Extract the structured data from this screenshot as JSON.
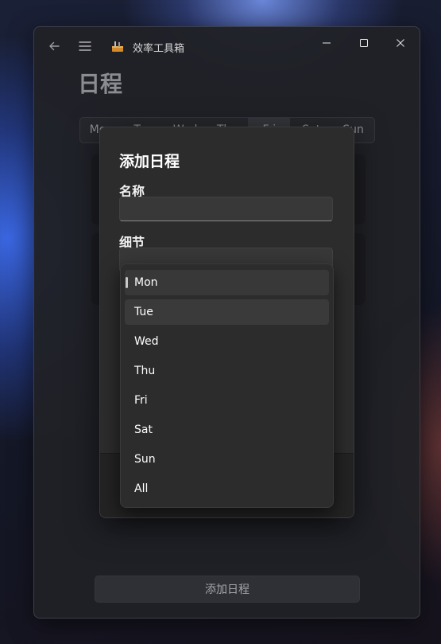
{
  "window": {
    "app_title": "效率工具箱",
    "icons": {
      "back": "back-arrow-icon",
      "menu": "hamburger-menu-icon",
      "app": "toolbox-app-icon"
    },
    "controls": {
      "minimize": "minimize-icon",
      "maximize": "maximize-icon",
      "close": "close-icon"
    }
  },
  "page": {
    "title": "日程",
    "days": [
      "Mon",
      "Tue",
      "Wed",
      "Thu",
      "Fri",
      "Sat",
      "Sun"
    ],
    "selected_day": "Fri",
    "add_button_label": "添加日程"
  },
  "dialog": {
    "title": "添加日程",
    "name_label": "名称",
    "name_value": "",
    "detail_label": "细节",
    "detail_value": ""
  },
  "dropdown": {
    "options": [
      "Mon",
      "Tue",
      "Wed",
      "Thu",
      "Fri",
      "Sat",
      "Sun",
      "All"
    ],
    "selected": "Mon",
    "hovered": "Tue"
  },
  "colors": {
    "accent": "#c8c8c8",
    "surface": "#2c2c2c",
    "background": "#202126"
  }
}
